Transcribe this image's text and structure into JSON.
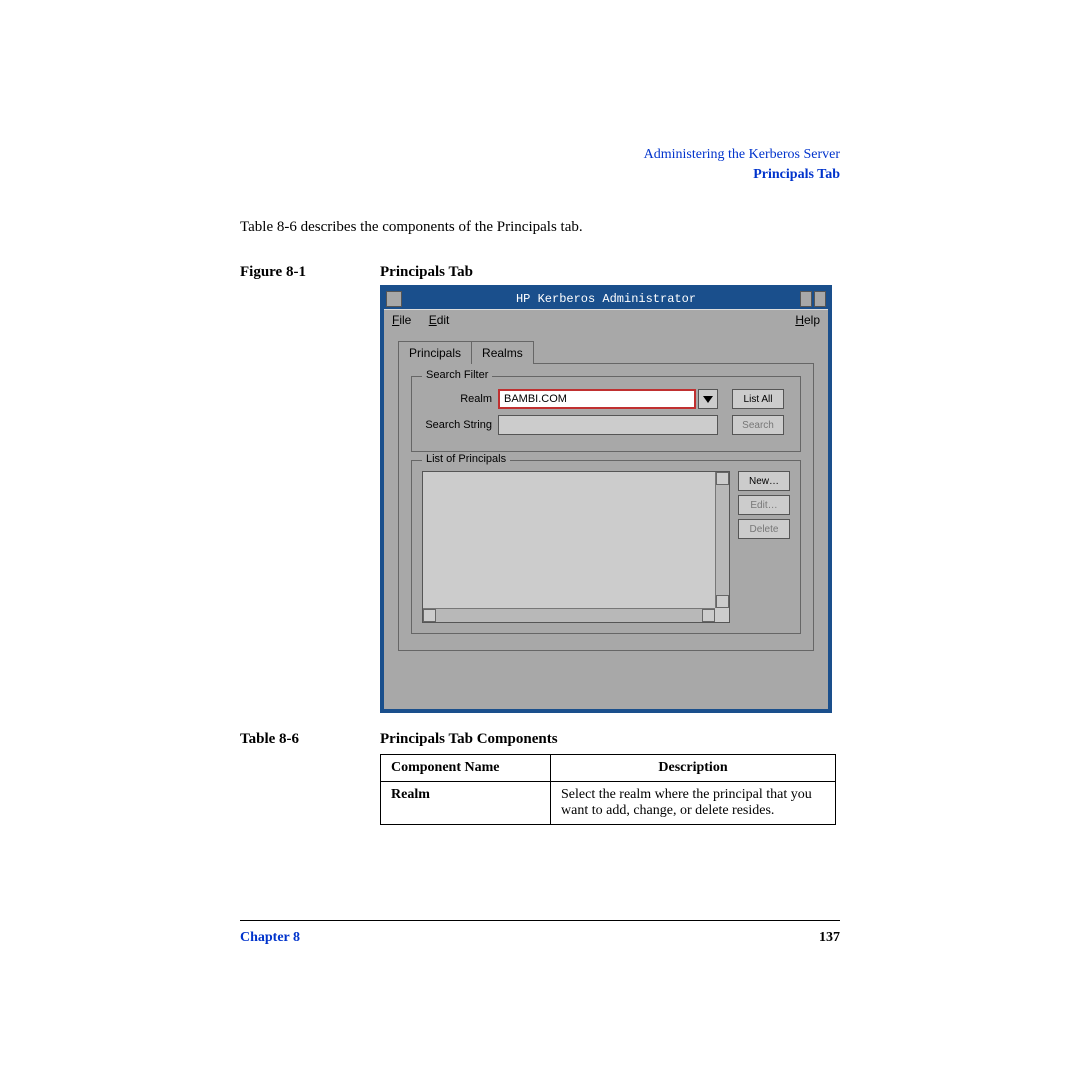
{
  "header": {
    "line1": "Administering the Kerberos Server",
    "line2": "Principals Tab"
  },
  "intro": "Table 8-6 describes the components of the Principals tab.",
  "figure": {
    "label": "Figure 8-1",
    "title": "Principals Tab"
  },
  "screenshot": {
    "title": "HP Kerberos Administrator",
    "menu": {
      "file": "File",
      "edit": "Edit",
      "help": "Help"
    },
    "tabs": {
      "principals": "Principals",
      "realms": "Realms"
    },
    "search_filter": {
      "legend": "Search Filter",
      "realm_label": "Realm",
      "realm_value": "BAMBI.COM",
      "list_all": "List All",
      "search_string_label": "Search String",
      "search_btn": "Search"
    },
    "list_legend": "List of Principals",
    "side": {
      "new_btn": "New…",
      "edit_btn": "Edit…",
      "delete_btn": "Delete"
    }
  },
  "table": {
    "label": "Table 8-6",
    "title": "Principals Tab Components",
    "headers": {
      "name": "Component Name",
      "desc": "Description"
    },
    "rows": [
      {
        "name": "Realm",
        "desc": "Select the realm where the principal that you want to add, change, or delete resides."
      }
    ]
  },
  "footer": {
    "chapter": "Chapter 8",
    "page": "137"
  }
}
